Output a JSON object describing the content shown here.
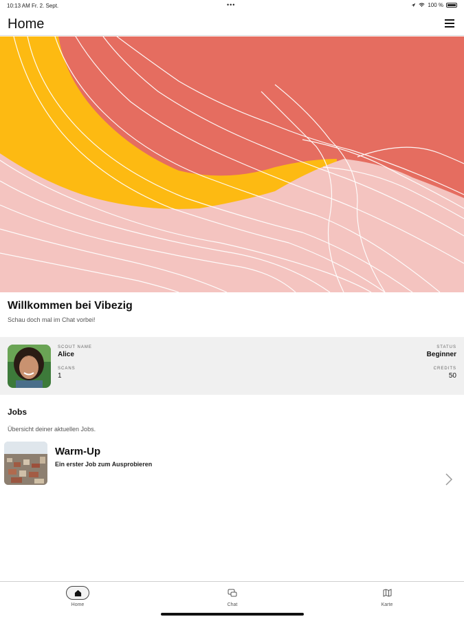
{
  "status_bar": {
    "time_date": "10:13 AM   Fr. 2. Sept.",
    "dots": "•••",
    "battery_text": "100 %"
  },
  "nav": {
    "title": "Home",
    "menu_icon": "hamburger-menu-icon"
  },
  "colors": {
    "coral": "#e56d60",
    "yellow": "#fdba12",
    "pink": "#f4c4c0",
    "card_bg": "#f0f0f0"
  },
  "welcome": {
    "title": "Willkommen bei Vibezig",
    "subtitle": "Schau doch mal im Chat vorbei!"
  },
  "profile": {
    "scout_name_label": "SCOUT NAME",
    "scout_name": "Alice",
    "scans_label": "SCANS",
    "scans": "1",
    "status_label": "STATUS",
    "status": "Beginner",
    "credits_label": "CREDITS",
    "credits": "50"
  },
  "jobs": {
    "title": "Jobs",
    "subtitle": "Übersicht deiner aktuellen Jobs.",
    "items": [
      {
        "title": "Warm-Up",
        "description": "Ein erster Job zum Ausprobieren"
      }
    ]
  },
  "tabs": [
    {
      "label": "Home",
      "icon": "home-icon",
      "active": true
    },
    {
      "label": "Chat",
      "icon": "chat-icon",
      "active": false
    },
    {
      "label": "Karte",
      "icon": "map-icon",
      "active": false
    }
  ]
}
